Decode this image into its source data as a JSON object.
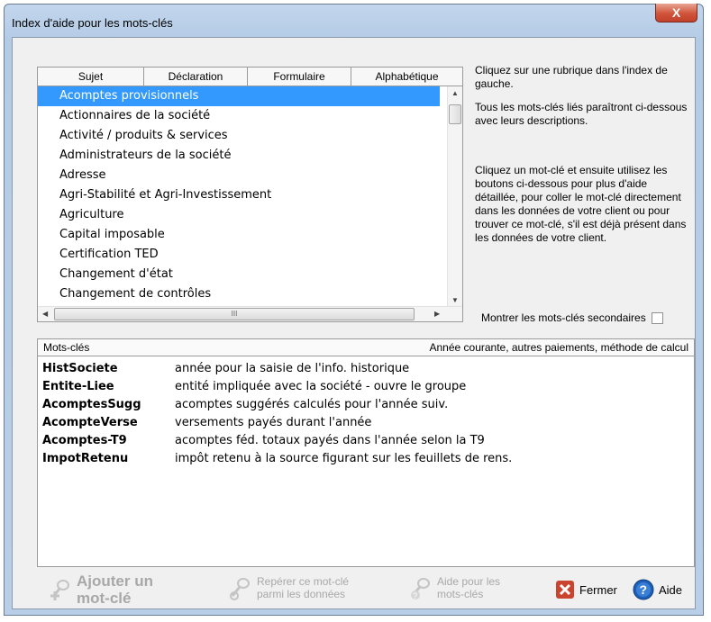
{
  "window": {
    "title": "Index d'aide pour les mots-clés",
    "close_glyph": "X"
  },
  "tabs": [
    "Sujet",
    "Déclaration",
    "Formulaire",
    "Alphabétique"
  ],
  "topics": [
    "Acomptes provisionnels",
    "Actionnaires de la société",
    "Activité / produits & services",
    "Administrateurs de la société",
    "Adresse",
    "Agri-Stabilité et Agri-Investissement",
    "Agriculture",
    "Capital imposable",
    "Certification TED",
    "Changement d'état",
    "Changement de contrôles"
  ],
  "selected_topic_index": 0,
  "info": {
    "para1": "Cliquez sur une rubrique dans l'index de gauche.",
    "para2": "Tous les mots-clés liés paraîtront ci-dessous avec leurs descriptions.",
    "para3": "Cliquez un mot-clé et ensuite utilisez les boutons ci-dessous pour plus d'aide détaillée, pour coller le mot-clé directement dans les données de votre client ou pour trouver ce mot-clé, s'il est déjà présent dans les données de votre client."
  },
  "secondary_checkbox": {
    "label": "Montrer les mots-clés secondaires",
    "checked": false
  },
  "keywords_header": {
    "left": "Mots-clés",
    "right": "Année courante, autres paiements, méthode de calcul"
  },
  "keywords": [
    {
      "name": "HistSociete",
      "desc": "année pour la saisie de l'info. historique"
    },
    {
      "name": "Entite-Liee",
      "desc": "entité impliquée avec la société - ouvre le groupe"
    },
    {
      "name": "AcomptesSugg",
      "desc": "acomptes suggérés calculés pour l'année suiv."
    },
    {
      "name": "AcompteVerse",
      "desc": "versements payés durant l'année"
    },
    {
      "name": "Acomptes-T9",
      "desc": "acomptes féd. totaux payés dans l'année selon la T9"
    },
    {
      "name": "ImpotRetenu",
      "desc": "impôt retenu à la source figurant sur les feuillets de rens."
    }
  ],
  "toolbar": {
    "add_line1": "Ajouter un",
    "add_line2": "mot-clé",
    "find_line1": "Repérer ce mot-clé",
    "find_line2": "parmi les données",
    "help_kw_line1": "Aide pour les",
    "help_kw_line2": "mots-clés",
    "close_label": "Fermer",
    "help_label": "Aide"
  },
  "colors": {
    "selection": "#3399ff",
    "close_button": "#c9452f",
    "help_icon": "#1d5fb8",
    "disabled_text": "#a8a8a8"
  },
  "icons": [
    "add-keyword-icon",
    "find-keyword-icon",
    "keyword-help-icon",
    "close-x-icon",
    "help-question-icon"
  ],
  "scroll_symbols": {
    "up": "▲",
    "down": "▼",
    "left": "◀",
    "right": "▶",
    "grip": "III"
  }
}
